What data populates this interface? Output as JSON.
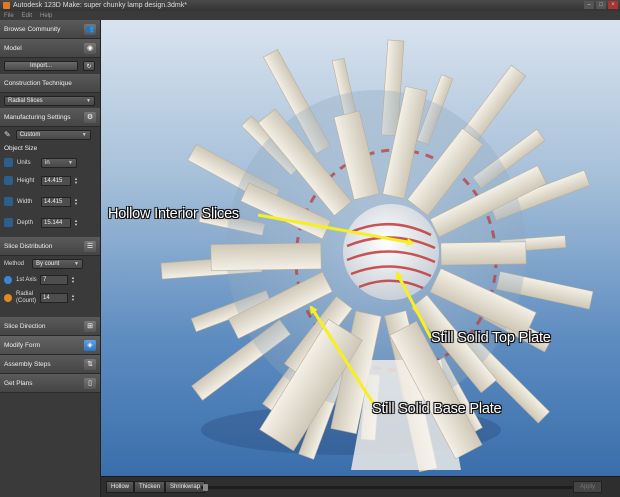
{
  "window": {
    "title": "Autodesk 123D Make: super chunky lamp design.3dmk*"
  },
  "menu": [
    "File",
    "Edit",
    "Help"
  ],
  "sidebar": {
    "browse_community": "Browse Community",
    "model": {
      "label": "Model",
      "import_label": "Import..."
    },
    "construction": {
      "label": "Construction Technique",
      "value": "Radial Slices"
    },
    "manufacturing": {
      "label": "Manufacturing Settings",
      "value": "Custom"
    },
    "object_size": {
      "label": "Object Size",
      "units_label": "Units",
      "units_value": "in",
      "height_label": "Height",
      "height_value": "14.415",
      "width_label": "Width",
      "width_value": "14.415",
      "depth_label": "Depth",
      "depth_value": "15.144"
    },
    "slice_distribution": {
      "label": "Slice Distribution",
      "method_label": "Method",
      "method_value": "By count",
      "axis_label": "1st Axis",
      "axis_value": "7",
      "radial_label": "Radial\n(Count)",
      "radial_value": "14"
    },
    "slice_direction": "Slice Direction",
    "modify_form": "Modify Form",
    "assembly_steps": "Assembly Steps",
    "get_plans": "Get Plans"
  },
  "bottom": {
    "tabs": [
      "Hollow",
      "Thicken",
      "Shrinkwrap"
    ],
    "apply_label": "Apply"
  },
  "annotations": {
    "hollow": "Hollow Interior Slices",
    "top_plate": "Still Solid Top Plate",
    "base_plate": "Still Solid Base Plate"
  },
  "colors": {
    "arrow": "#f5f01e",
    "accent_blue": "#3a86d4",
    "slice_face": "#e8e2d6",
    "red_edge": "#c23a3a"
  }
}
